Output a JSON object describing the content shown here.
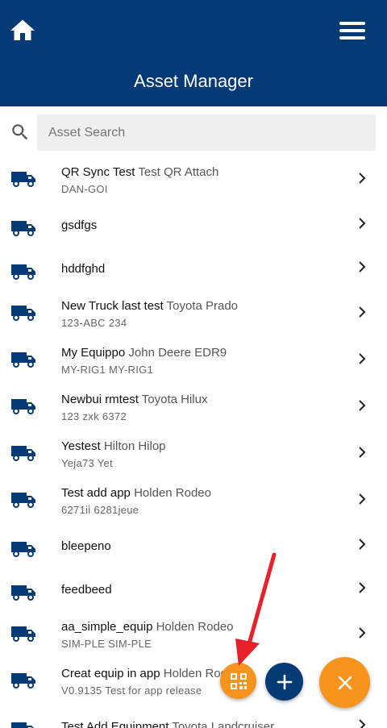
{
  "header": {
    "title": "Asset Manager"
  },
  "search": {
    "placeholder": "Asset Search"
  },
  "assets": [
    {
      "name": "QR Sync Test",
      "model": "Test QR Attach",
      "sub": "DAN-GOI"
    },
    {
      "name": "gsdfgs",
      "model": "",
      "sub": ""
    },
    {
      "name": "hddfghd",
      "model": "",
      "sub": ""
    },
    {
      "name": "New Truck last test",
      "model": "Toyota Prado",
      "sub": "123-ABC 234"
    },
    {
      "name": "My Equippo",
      "model": "John Deere EDR9",
      "sub": "MY-RIG1 MY-RIG1"
    },
    {
      "name": "Newbui rmtest",
      "model": "Toyota Hilux",
      "sub": "123 zxk 6372"
    },
    {
      "name": "Yestest",
      "model": "Hilton Hilop",
      "sub": "Yeja73 Yet"
    },
    {
      "name": "Test add app",
      "model": "Holden Rodeo",
      "sub": "6271ii 6281jeue"
    },
    {
      "name": "bleepeno",
      "model": "",
      "sub": ""
    },
    {
      "name": "feedbeed",
      "model": "",
      "sub": ""
    },
    {
      "name": "aa_simple_equip",
      "model": "Holden Rodeo",
      "sub": "SIM-PLE SIM-PLE"
    },
    {
      "name": "Creat equip in app",
      "model": "Holden Rodeo",
      "sub": "V0.9135 Test for app release"
    },
    {
      "name": "Test Add Equipment",
      "model": "Toyota Landcruiser",
      "sub": ""
    }
  ],
  "colors": {
    "primary": "#063a74",
    "accent": "#f7941d",
    "annotation": "#e8202a"
  },
  "icons": {
    "home": "home-icon",
    "menu": "hamburger-menu-icon",
    "search": "search-icon",
    "truck": "truck-icon",
    "chevron": "chevron-right-icon",
    "qr": "qr-code-icon",
    "add": "plus-icon",
    "close": "close-icon"
  }
}
